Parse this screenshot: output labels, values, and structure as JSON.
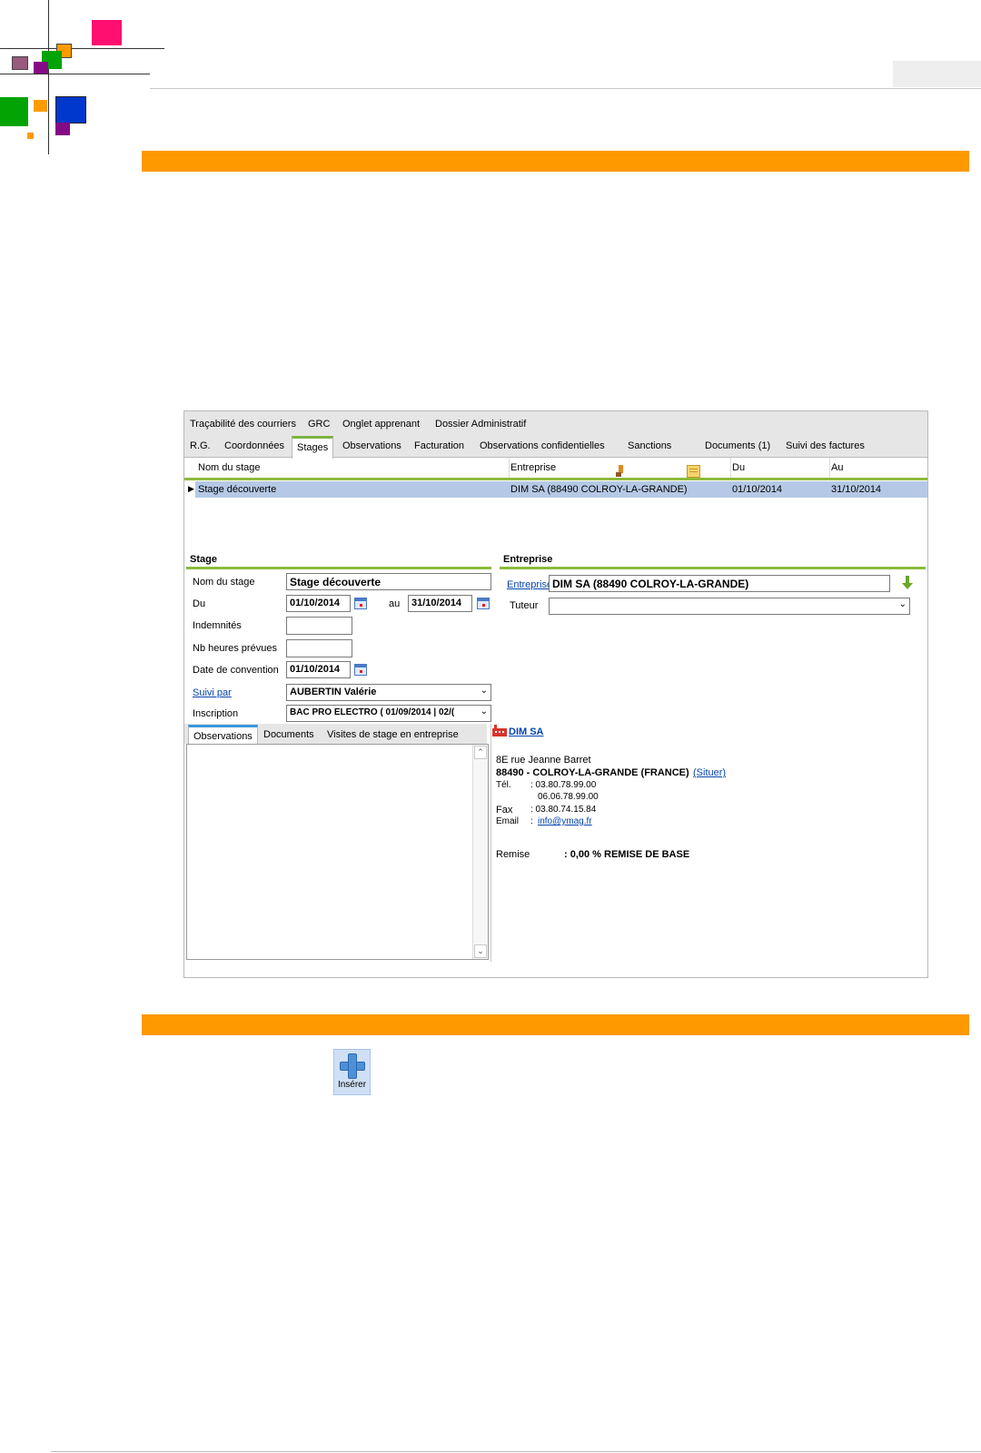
{
  "window": {
    "tabs_row1": [
      "Traçabilité des courriers",
      "GRC",
      "Onglet apprenant",
      "Dossier Administratif"
    ],
    "tabs_row2": [
      "R.G.",
      "Coordonnées",
      "Stages",
      "Observations",
      "Facturation",
      "Observations confidentielles",
      "Sanctions",
      "Documents (1)",
      "Suivi des factures"
    ],
    "active_tab": "Stages",
    "grid": {
      "columns": [
        "Nom du stage",
        "Entreprise",
        "Du",
        "Au"
      ],
      "rows": [
        [
          "Stage découverte",
          "DIM SA (88490 COLROY-LA-GRANDE)",
          "01/10/2014",
          "31/10/2014"
        ]
      ]
    },
    "stage": {
      "title": "Stage",
      "labels": {
        "nom": "Nom du stage",
        "du": "Du",
        "au": "au",
        "indemnites": "Indemnités",
        "nb_heures": "Nb heures prévues",
        "date_convention": "Date de convention",
        "suivi_par": "Suivi par",
        "inscription": "Inscription"
      },
      "values": {
        "nom": "Stage découverte",
        "du": "01/10/2014",
        "au": "31/10/2014",
        "indemnites": "",
        "nb_heures": "",
        "date_convention": "01/10/2014",
        "suivi_par": "AUBERTIN Valérie",
        "inscription": "BAC PRO ELECTRO ( 01/09/2014 | 02/("
      }
    },
    "entreprise": {
      "title": "Entreprise",
      "labels": {
        "entreprise": "Entreprise",
        "tuteur": "Tuteur"
      },
      "values": {
        "entreprise": "DIM SA (88490 COLROY-LA-GRANDE)",
        "tuteur": ""
      }
    },
    "sub_tabs": [
      "Observations",
      "Documents",
      "Visites de stage en entreprise"
    ],
    "company_card": {
      "name": "DIM SA",
      "address": "8E rue Jeanne Barret",
      "city": "88490 - COLROY-LA-GRANDE (FRANCE)",
      "locate_link": "(Situer)",
      "tel_label": "Tél.",
      "tel1": ": 03.80.78.99.00",
      "tel2": "06.06.78.99.00",
      "fax_label": "Fax",
      "fax": ": 03.80.74.15.84",
      "email_label": "Email",
      "email_sep": ":",
      "email": "info@ymag.fr",
      "remise_label": "Remise",
      "remise_value": ": 0,00 % REMISE DE BASE"
    }
  },
  "insert_button": {
    "label": "Insérer"
  },
  "colors": {
    "orange_bar": "#ff9900",
    "section_green": "#8dbb3c",
    "selected_row": "#b5c9e6",
    "logo_pink": "#ff0f6f",
    "logo_green": "#04a304",
    "logo_blue": "#0037cc",
    "logo_orange": "#ff9b00",
    "logo_purple": "#850a85",
    "logo_mauve": "#995a7e"
  }
}
